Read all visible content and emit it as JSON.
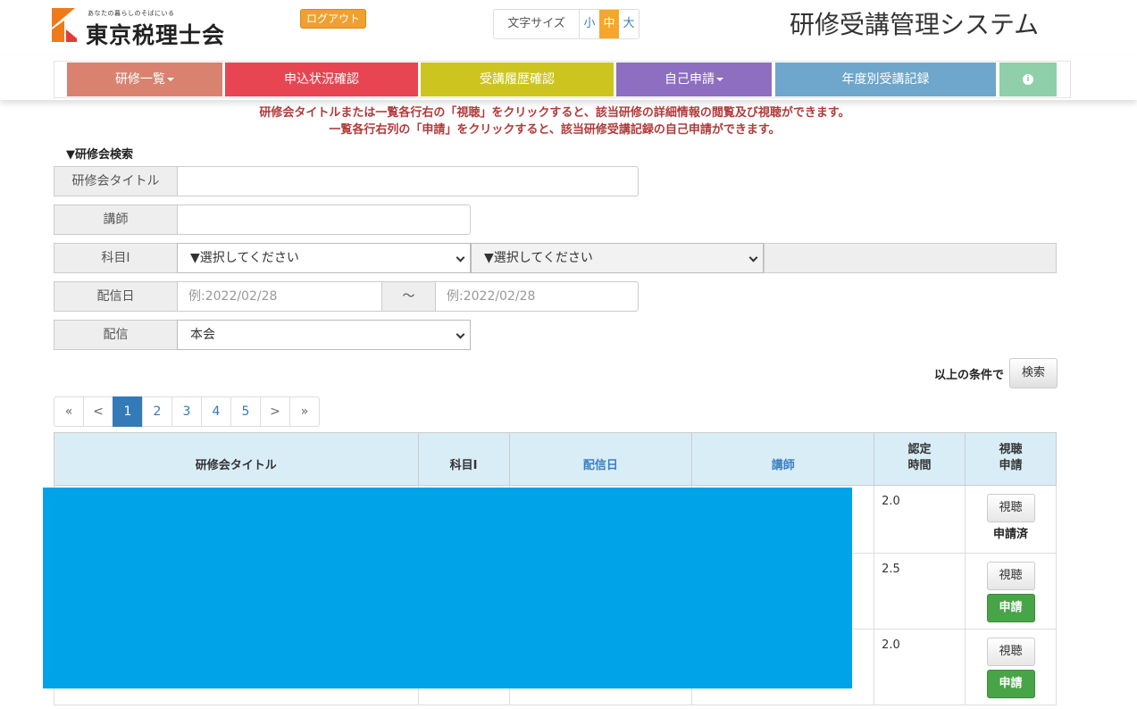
{
  "header": {
    "logo_tagline": "あなたの暮らしのそばにいる",
    "logo_name": "東京税理士会",
    "logout_label": "ログアウト",
    "font_size_label": "文字サイズ",
    "font_sizes": [
      "小",
      "中",
      "大"
    ],
    "font_size_selected": "中",
    "system_title": "研修受講管理システム"
  },
  "nav": {
    "items": [
      {
        "label": "研修一覧",
        "color": "#d98270",
        "dropdown": true
      },
      {
        "label": "申込状況確認",
        "color": "#e74552",
        "dropdown": false
      },
      {
        "label": "受講履歴確認",
        "color": "#cdc51f",
        "dropdown": false
      },
      {
        "label": "自己申請",
        "color": "#8e6ec0",
        "dropdown": true
      },
      {
        "label": "年度別受講記録",
        "color": "#6fa6cb",
        "dropdown": false
      },
      {
        "label": "i",
        "color": "#8fcfa9",
        "dropdown": false
      }
    ]
  },
  "notice": {
    "line1": "研修会タイトルまたは一覧各行右の「視聴」をクリックすると、該当研修の詳細情報の閲覧及び視聴ができます。",
    "line2": "一覧各行右列の「申請」をクリックすると、該当研修受講記録の自己申請ができます。"
  },
  "search": {
    "section_title": "▼研修会検索",
    "title_label": "研修会タイトル",
    "title_value": "",
    "lecturer_label": "講師",
    "lecturer_value": "",
    "subject_label": "科目Ⅰ",
    "subject_select1": "▼選択してください",
    "subject_select2": "▼選択してください",
    "date_label": "配信日",
    "date_from_placeholder": "例:2022/02/28",
    "date_separator": "～",
    "date_to_placeholder": "例:2022/02/28",
    "delivery_label": "配信",
    "delivery_value": "本会",
    "submit_prefix": "以上の条件で",
    "submit_label": "検索"
  },
  "pagination": {
    "items": [
      "«",
      "<",
      "1",
      "2",
      "3",
      "4",
      "5",
      ">",
      "»"
    ],
    "current": "1"
  },
  "table": {
    "headers": {
      "title": "研修会タイトル",
      "subject": "科目Ⅰ",
      "date": "配信日",
      "lecturer": "講師",
      "hours_line1": "認定",
      "hours_line2": "時間",
      "action_line1": "視聴",
      "action_line2": "申請"
    },
    "view_label": "視聴",
    "apply_label": "申請",
    "applied_label": "申請済",
    "rows": [
      {
        "hours": "2.0"
      },
      {
        "hours": "2.5"
      },
      {
        "hours": "2.0"
      }
    ]
  }
}
